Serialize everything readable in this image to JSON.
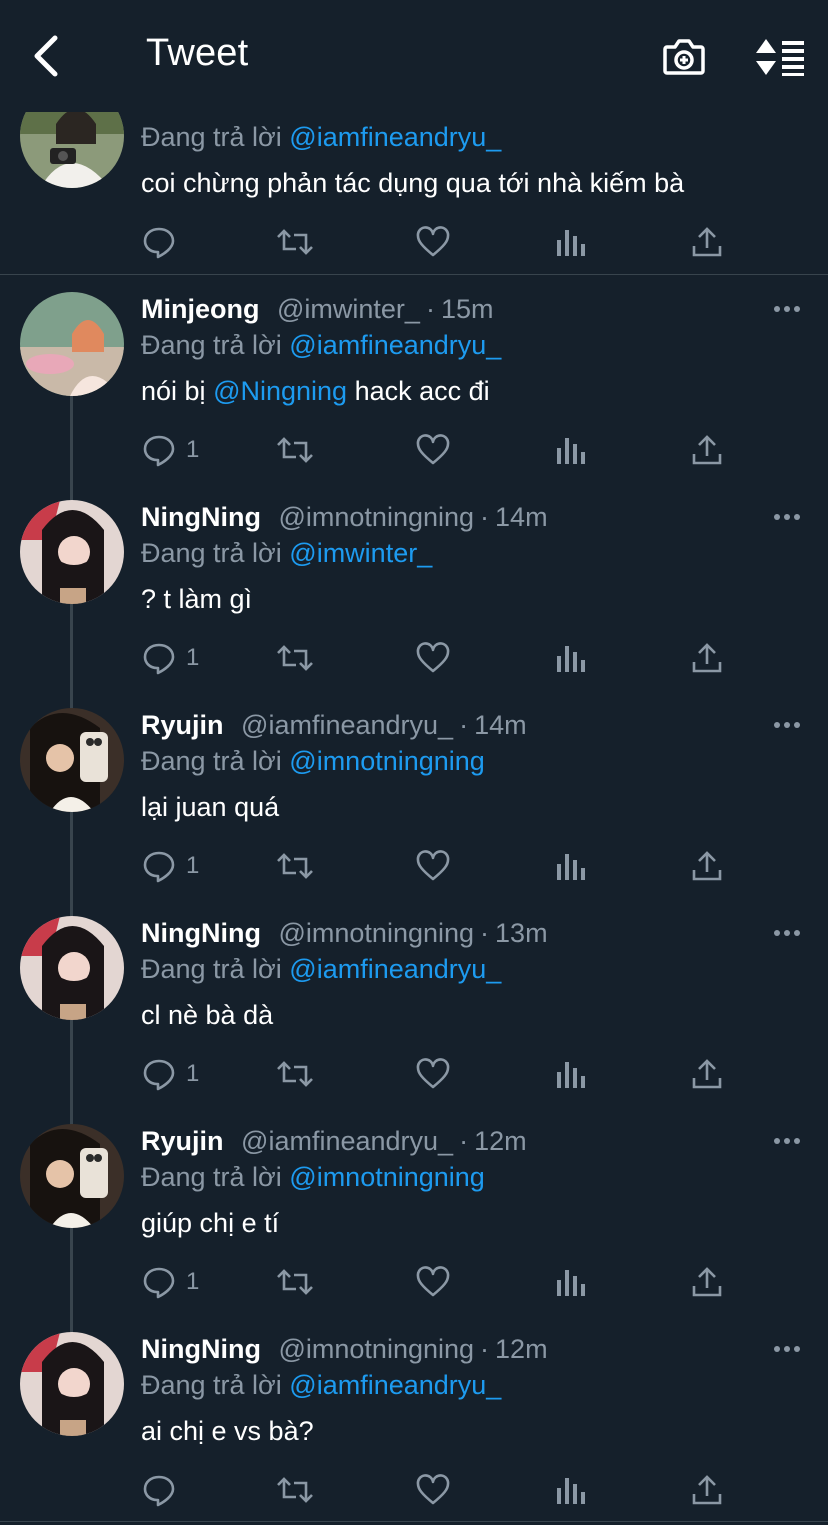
{
  "header": {
    "title": "Tweet"
  },
  "top_tweet": {
    "replying_prefix": "Đang trả lời",
    "replying_to": "@iamfineandryu_",
    "text": "coi chừng phản tác dụng qua tới nhà kiếm bà"
  },
  "tweets": [
    {
      "name": "Minjeong",
      "handle": "@imwinter_",
      "time": "15m",
      "replying_prefix": "Đang trả lời",
      "replying_to": "@iamfineandryu_",
      "text_before": "nói bị ",
      "text_mention": "@Ningning",
      "text_after": " hack acc đi",
      "reply_count": "1"
    },
    {
      "name": "NingNing",
      "handle": "@imnotningning",
      "time": "14m",
      "replying_prefix": "Đang trả lời",
      "replying_to": "@imwinter_",
      "text": "? t làm gì",
      "reply_count": "1"
    },
    {
      "name": "Ryujin",
      "handle": "@iamfineandryu_",
      "time": "14m",
      "replying_prefix": "Đang trả lời",
      "replying_to": "@imnotningning",
      "text": "lại juan quá",
      "reply_count": "1"
    },
    {
      "name": "NingNing",
      "handle": "@imnotningning",
      "time": "13m",
      "replying_prefix": "Đang trả lời",
      "replying_to": "@iamfineandryu_",
      "text": "cl nè bà dà",
      "reply_count": "1"
    },
    {
      "name": "Ryujin",
      "handle": "@iamfineandryu_",
      "time": "12m",
      "replying_prefix": "Đang trả lời",
      "replying_to": "@imnotningning",
      "text": "giúp chị e tí",
      "reply_count": "1"
    },
    {
      "name": "NingNing",
      "handle": "@imnotningning",
      "time": "12m",
      "replying_prefix": "Đang trả lời",
      "replying_to": "@iamfineandryu_",
      "text": "ai chị e vs bà?",
      "reply_count": ""
    }
  ],
  "icons": {
    "back": "chevron-left-icon",
    "camera": "camera-plus-icon",
    "sort": "sort-icon",
    "reply": "reply-icon",
    "retweet": "retweet-icon",
    "like": "heart-icon",
    "views": "analytics-icon",
    "share": "share-icon",
    "more": "more-icon"
  },
  "colors": {
    "background": "#15202b",
    "mention": "#1d9bf0",
    "secondary_text": "#8b98a5",
    "divider": "#38444d"
  }
}
